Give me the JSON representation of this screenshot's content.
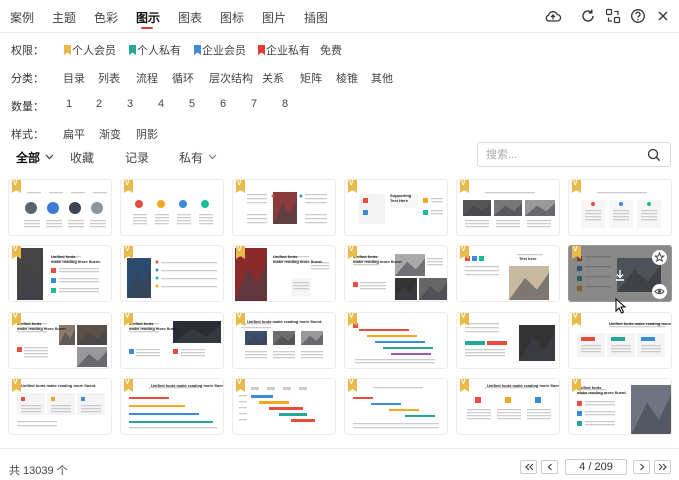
{
  "tabs": [
    {
      "label": "案例",
      "active": false
    },
    {
      "label": "主题",
      "active": false
    },
    {
      "label": "色彩",
      "active": false
    },
    {
      "label": "图示",
      "active": true
    },
    {
      "label": "图表",
      "active": false
    },
    {
      "label": "图标",
      "active": false
    },
    {
      "label": "图片",
      "active": false
    },
    {
      "label": "插图",
      "active": false
    }
  ],
  "toolbar_icons": [
    "cloud-upload-icon",
    "refresh-icon",
    "layout-switch-icon",
    "help-icon",
    "close-icon"
  ],
  "filters": {
    "permission": {
      "label": "权限：",
      "options": [
        {
          "label": "个人会员",
          "badge": "#e9b949"
        },
        {
          "label": "个人私有",
          "badge": "#26a69a"
        },
        {
          "label": "企业会员",
          "badge": "#3f8bd8"
        },
        {
          "label": "企业私有",
          "badge": "#e53935"
        },
        {
          "label": "免费",
          "badge": null
        }
      ]
    },
    "category": {
      "label": "分类：",
      "options": [
        "目录",
        "列表",
        "流程",
        "循环",
        "层次结构",
        "关系",
        "矩阵",
        "棱锥",
        "其他"
      ]
    },
    "quantity": {
      "label": "数量：",
      "options": [
        "1",
        "2",
        "3",
        "4",
        "5",
        "6",
        "7",
        "8"
      ]
    },
    "style": {
      "label": "样式：",
      "options": [
        "扁平",
        "渐变",
        "阴影"
      ]
    }
  },
  "subtabs": {
    "all": "全部",
    "favorites": "收藏",
    "history": "记录",
    "private": "私有"
  },
  "search": {
    "placeholder": "搜索..."
  },
  "thumbnail_text": {
    "heading": "Unified fonts make reading more fluent.",
    "heading_line1": "Unified fonts",
    "heading_line2": "make reading more fluent.",
    "supporting_line1": "Supporting",
    "supporting_line2": "Text Here",
    "text_here": "Text here"
  },
  "templates_count": 24,
  "footer": {
    "total": "共 13039 个",
    "page_display": "4 / 209"
  },
  "colors": {
    "accent_red": "#e53935",
    "badge_gold": "#e9b949",
    "badge_teal": "#26a69a",
    "badge_blue": "#3f8bd8"
  }
}
